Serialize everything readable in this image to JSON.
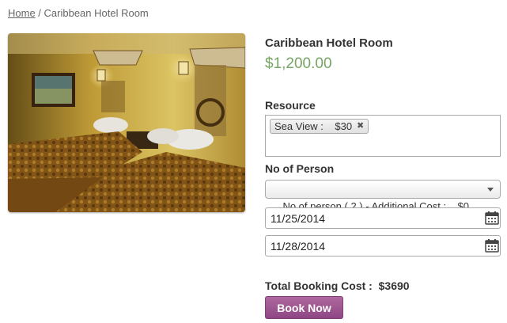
{
  "breadcrumb": {
    "home": "Home",
    "separator": " / ",
    "current": "Caribbean Hotel Room"
  },
  "product": {
    "title": "Caribbean Hotel Room",
    "price": "$1,200.00"
  },
  "resource": {
    "label": "Resource",
    "chip": "Sea View :    $30",
    "remove_icon": "close-icon"
  },
  "persons": {
    "label": "No of Person",
    "selected": "No of person ( 2 ) - Additional Cost :    $0"
  },
  "dates": {
    "start": "11/25/2014",
    "end": "11/28/2014",
    "icon": "calendar-icon"
  },
  "total": {
    "label": "Total Booking Cost :",
    "value": "$3690"
  },
  "book_button": {
    "label": "Book Now"
  },
  "colors": {
    "price": "#77a464",
    "button": "#9b5593",
    "link": "#666666"
  }
}
